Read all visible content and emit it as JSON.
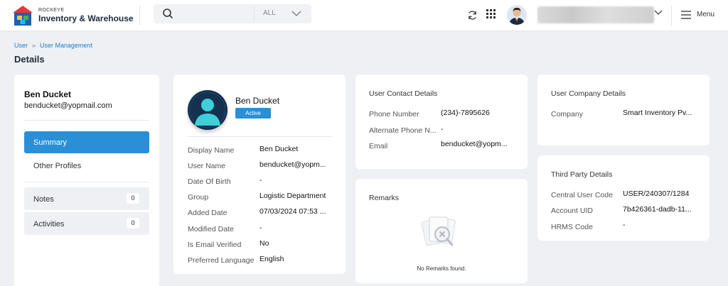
{
  "header": {
    "brand_small": "ROCKEYE",
    "brand_name": "Inventory & Warehouse",
    "search_placeholder": "",
    "search_filter": "ALL",
    "menu_label": "Menu"
  },
  "breadcrumb": [
    "User",
    "User Management"
  ],
  "page_title": "Details",
  "sidebar": {
    "name": "Ben Ducket",
    "email": "benducket@yopmail.com",
    "nav": [
      {
        "label": "Summary",
        "active": true
      },
      {
        "label": "Other Profiles"
      }
    ],
    "boxes": [
      {
        "label": "Notes",
        "count": "0"
      },
      {
        "label": "Activities",
        "count": "0"
      }
    ]
  },
  "profile": {
    "name": "Ben Ducket",
    "status": "Active",
    "status_color": "#2a8fd6",
    "details": [
      {
        "label": "Display Name",
        "value": "Ben Ducket"
      },
      {
        "label": "User Name",
        "value": "benducket@yopm..."
      },
      {
        "label": "Date Of Birth",
        "value": "-"
      },
      {
        "label": "Group",
        "value": "Logistic Department"
      },
      {
        "label": "Added Date",
        "value": "07/03/2024 07:53 ..."
      },
      {
        "label": "Modified Date",
        "value": "-"
      },
      {
        "label": "Is Email Verified",
        "value": "No"
      },
      {
        "label": "Preferred Language",
        "value": "English"
      }
    ]
  },
  "contact": {
    "title": "User Contact Details",
    "rows": [
      {
        "label": "Phone Number",
        "value": "(234)-7895626"
      },
      {
        "label": "Alternate Phone N...",
        "value": "-"
      },
      {
        "label": "Email",
        "value": "benducket@yopm..."
      }
    ]
  },
  "remarks": {
    "title": "Remarks",
    "empty_text": "No Remarks found."
  },
  "company": {
    "title": "User Company Details",
    "rows": [
      {
        "label": "Company",
        "value": "Smart Inventory Pv..."
      }
    ]
  },
  "third_party": {
    "title": "Third Party Details",
    "rows": [
      {
        "label": "Central User Code",
        "value": "USER/240307/1284"
      },
      {
        "label": "Account UID",
        "value": "7b426361-dadb-11..."
      },
      {
        "label": "HRMS Code",
        "value": "-"
      }
    ]
  },
  "colors": {
    "accent": "#2a8fd6",
    "link": "#1e7fc6",
    "background": "#eef0f3"
  }
}
